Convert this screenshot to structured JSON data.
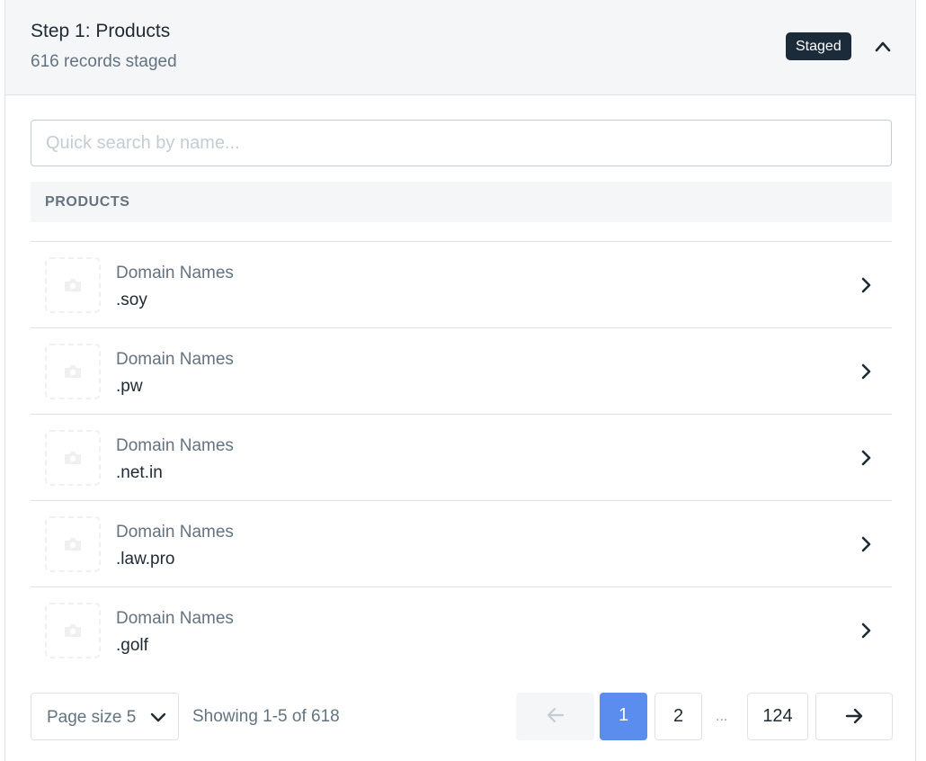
{
  "header": {
    "title": "Step 1: Products",
    "subtitle": "616 records staged",
    "badge": "Staged",
    "toggle_icon": "chevron-up-icon"
  },
  "search": {
    "placeholder": "Quick search by name...",
    "value": ""
  },
  "section": {
    "title": "PRODUCTS"
  },
  "products": [
    {
      "category": "Domain Names",
      "name": ".soy"
    },
    {
      "category": "Domain Names",
      "name": ".pw"
    },
    {
      "category": "Domain Names",
      "name": ".net.in"
    },
    {
      "category": "Domain Names",
      "name": ".law.pro"
    },
    {
      "category": "Domain Names",
      "name": ".golf"
    }
  ],
  "footer": {
    "page_size_label": "Page size 5",
    "showing": "Showing 1-5 of 618",
    "pagination": {
      "current": "1",
      "next_page": "2",
      "ellipsis": "...",
      "last": "124"
    }
  },
  "colors": {
    "accent": "#5b8def",
    "badge_bg": "#1c2b39",
    "header_bg": "#f4f6f8",
    "border": "#dfe3e8"
  }
}
